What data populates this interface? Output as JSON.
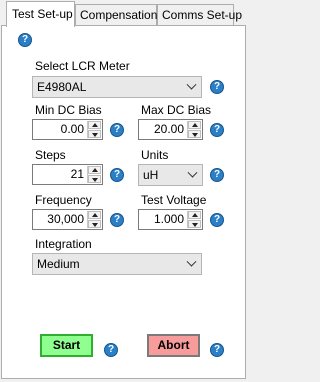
{
  "tabs": [
    {
      "label": "Test Set-up",
      "active": true
    },
    {
      "label": "Compensation",
      "active": false
    },
    {
      "label": "Comms Set-up",
      "active": false
    }
  ],
  "help_glyph": "?",
  "meter": {
    "label": "Select LCR Meter",
    "value": "E4980AL"
  },
  "min_dc_bias": {
    "label": "Min DC Bias",
    "value": "0.00"
  },
  "max_dc_bias": {
    "label": "Max DC Bias",
    "value": "20.00"
  },
  "steps": {
    "label": "Steps",
    "value": "21"
  },
  "units": {
    "label": "Units",
    "value": "uH"
  },
  "frequency": {
    "label": "Frequency",
    "value": "30,000"
  },
  "test_voltage": {
    "label": "Test Voltage",
    "value": "1.000"
  },
  "integration": {
    "label": "Integration",
    "value": "Medium"
  },
  "buttons": {
    "start": "Start",
    "abort": "Abort"
  },
  "colors": {
    "start_bg": "#8fff8f",
    "abort_bg": "#f79b9b",
    "help_blue": "#2a7fc6"
  }
}
